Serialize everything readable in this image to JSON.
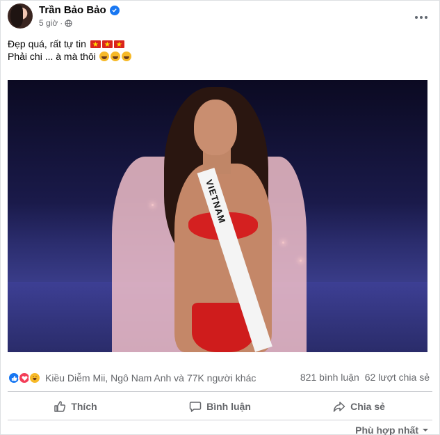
{
  "post": {
    "author": "Trần Bảo Bảo",
    "time": "5 giờ",
    "caption_line1": "Đẹp quá, rất tự tin",
    "caption_line2": "Phải chi ... à mà thôi",
    "photo_sash_text": "VIETNAM"
  },
  "reactions": {
    "icons": [
      "like-icon",
      "love-icon",
      "haha-icon"
    ],
    "text": "Kiều Diễm Mii, Ngô Nam Anh và 77K người khác",
    "comments": "821 bình luận",
    "shares": "62 lượt chia sẻ"
  },
  "actions": {
    "like": "Thích",
    "comment": "Bình luận",
    "share": "Chia sẻ"
  },
  "sort_label": "Phù hợp nhất",
  "colors": {
    "accent": "#1877f2",
    "love": "#f33e58",
    "haha": "#f7b928",
    "muted": "#65676b"
  }
}
